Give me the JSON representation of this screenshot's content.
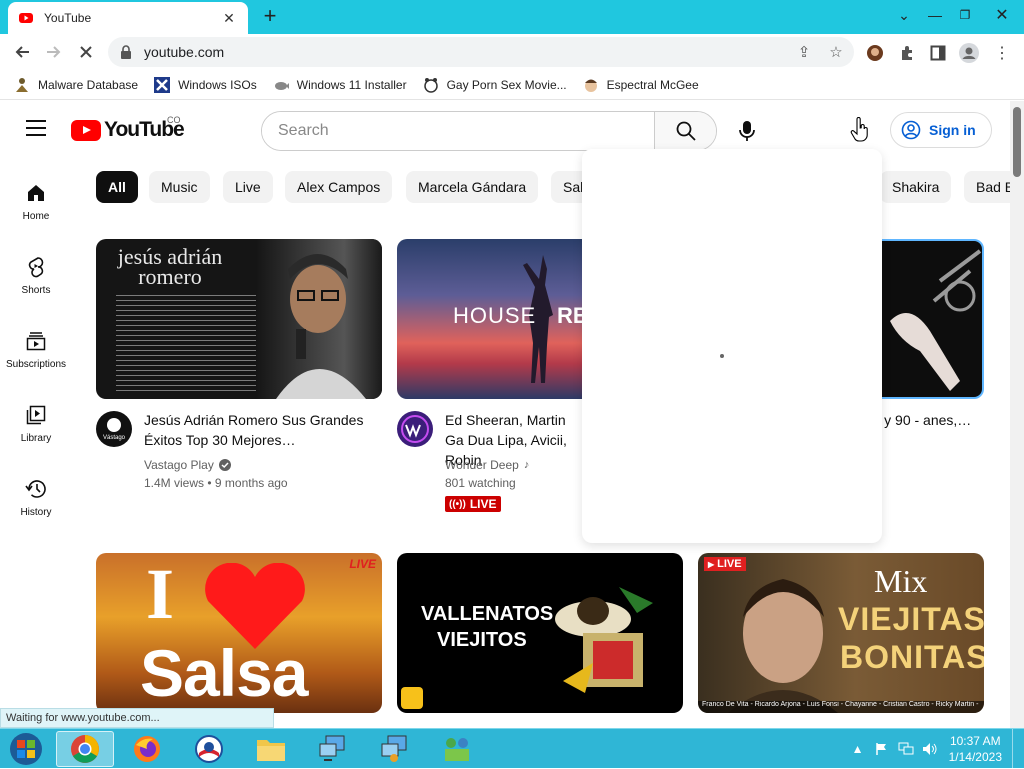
{
  "browser": {
    "tab_title": "YouTube",
    "url": "youtube.com",
    "accent": "#20c7df"
  },
  "bookmarks": [
    {
      "label": "Malware Database",
      "icon": "hazard-person-icon"
    },
    {
      "label": "Windows ISOs",
      "icon": "x-box-icon"
    },
    {
      "label": "Windows 11 Installer",
      "icon": "fish-icon"
    },
    {
      "label": "Gay Porn Sex Movie...",
      "icon": "bear-icon"
    },
    {
      "label": "Espectral McGee",
      "icon": "face-icon"
    }
  ],
  "header": {
    "logo_text": "YouTube",
    "country_code": "CO",
    "search_placeholder": "Search",
    "signin_label": "Sign in"
  },
  "sidebar": [
    {
      "label": "Home",
      "icon": "home-icon"
    },
    {
      "label": "Shorts",
      "icon": "shorts-icon"
    },
    {
      "label": "Subscriptions",
      "icon": "subscriptions-icon"
    },
    {
      "label": "Library",
      "icon": "library-icon"
    },
    {
      "label": "History",
      "icon": "history-icon"
    }
  ],
  "chips": [
    "All",
    "Music",
    "Live",
    "Alex Campos",
    "Marcela Gándara",
    "Sal",
    "Shakira",
    "Bad B"
  ],
  "videos": [
    {
      "thumb_title": "jesús adrián romero",
      "title": "Jesús Adrián Romero Sus Grandes Éxitos Top 30 Mejores…",
      "channel": "Vastago Play",
      "avatar_label": "Vástago",
      "meta": "1.4M views • 9 months ago"
    },
    {
      "thumb_text_1": "HOUSE",
      "thumb_text_2": "RE",
      "title": "Ed Sheeran, Martin Ga Dua Lipa, Avicii, Robin",
      "channel": "Wonder Deep",
      "meta": "801 watching",
      "live_label": "LIVE"
    },
    {
      "title": "os 80 y 90 - anes,…"
    }
  ],
  "videos_row2": [
    {
      "thumb_i": "I",
      "thumb_salsa": "Salsa",
      "thumb_live": "LIVE"
    },
    {
      "thumb_line1": "VALLENATOS",
      "thumb_line2": "VIEJITOS"
    },
    {
      "thumb_live": "LIVE",
      "thumb_mix": "Mix",
      "thumb_line1": "VIEJITAS",
      "thumb_line2": "BONITAS",
      "thumb_credits": "Franco De Vita - Ricardo Arjona - Luis Fonsi - Chayanne - Cristian Castro - Ricky Martin -"
    }
  ],
  "status_text": "Waiting for www.youtube.com...",
  "taskbar": {
    "time": "10:37 AM",
    "date": "1/14/2023"
  }
}
